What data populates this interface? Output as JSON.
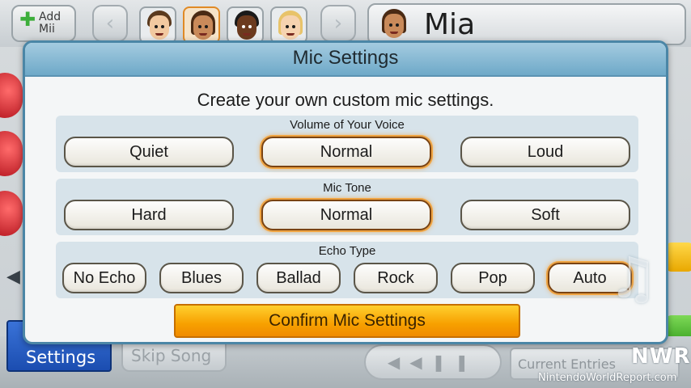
{
  "top_bar": {
    "add_mii_label_1": "Add",
    "add_mii_label_2": "Mii",
    "prev_arrow": "‹",
    "next_arrow": "›",
    "player_name": "Mia"
  },
  "modal": {
    "title": "Mic Settings",
    "subtitle": "Create your own custom mic settings.",
    "sections": [
      {
        "label": "Volume of Your Voice",
        "options": [
          "Quiet",
          "Normal",
          "Loud"
        ],
        "selected": "Normal"
      },
      {
        "label": "Mic Tone",
        "options": [
          "Hard",
          "Normal",
          "Soft"
        ],
        "selected": "Normal"
      },
      {
        "label": "Echo Type",
        "options": [
          "No Echo",
          "Blues",
          "Ballad",
          "Rock",
          "Pop",
          "Auto"
        ],
        "selected": "Auto"
      }
    ],
    "confirm_label": "Confirm Mic Settings"
  },
  "bottom_bar": {
    "settings_label": "Settings",
    "skip_label": "Skip Song",
    "entries_label": "Current Entries"
  },
  "watermark": {
    "logo": "NWR",
    "site": "NintendoWorldReport.com"
  },
  "colors": {
    "header_blue": "#6ea9c8",
    "confirm_orange": "#f7a000",
    "selected_glow": "#f0a441",
    "settings_blue": "#1b4db0"
  }
}
